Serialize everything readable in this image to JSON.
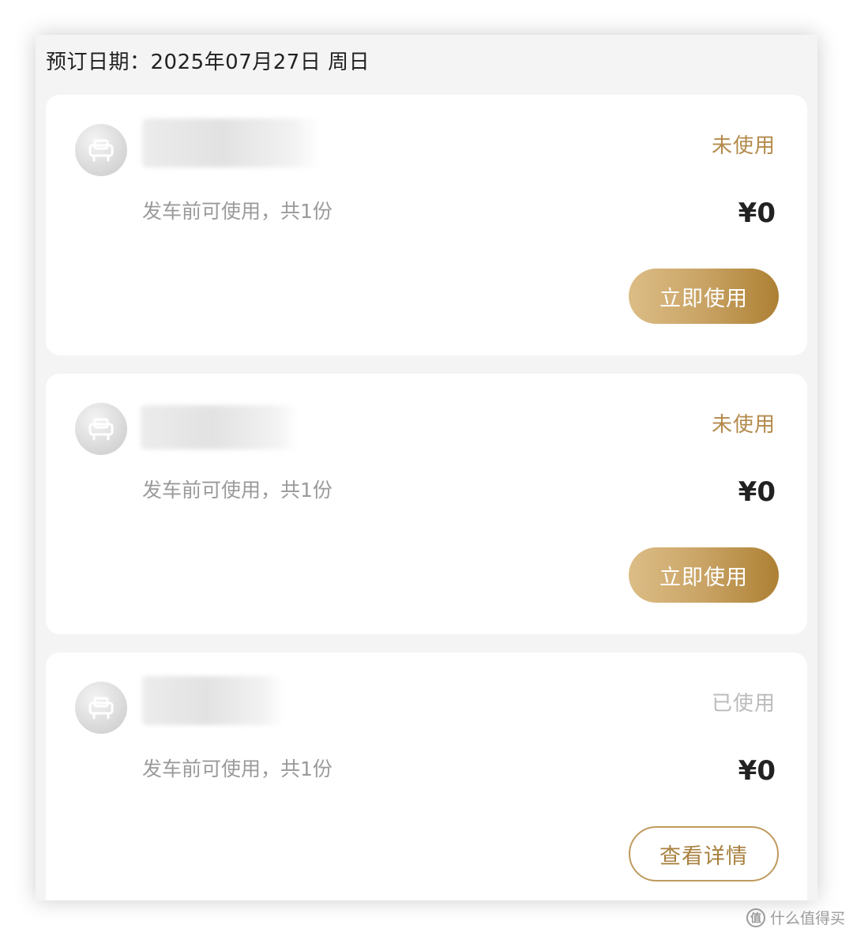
{
  "booking": {
    "label": "预订日期：",
    "date": "2025年07月27日 周日"
  },
  "colors": {
    "accent": "#b38a4b",
    "used_status": "#bbbbbb",
    "button_gradient_start": "#dcbd86",
    "button_gradient_end": "#ad8033"
  },
  "coupons": [
    {
      "title": "",
      "icon": "seat-icon",
      "status": "未使用",
      "description": "发车前可使用，共1份",
      "price": "¥0",
      "action_label": "立即使用"
    },
    {
      "title": "",
      "icon": "seat-icon",
      "status": "未使用",
      "description": "发车前可使用，共1份",
      "price": "¥0",
      "action_label": "立即使用"
    },
    {
      "title": "",
      "icon": "seat-icon",
      "status": "已使用",
      "description": "发车前可使用，共1份",
      "price": "¥0",
      "action_label": "查看详情"
    }
  ],
  "watermark": {
    "icon": "zhi-logo-icon",
    "icon_glyph": "值",
    "text": "什么值得买"
  }
}
